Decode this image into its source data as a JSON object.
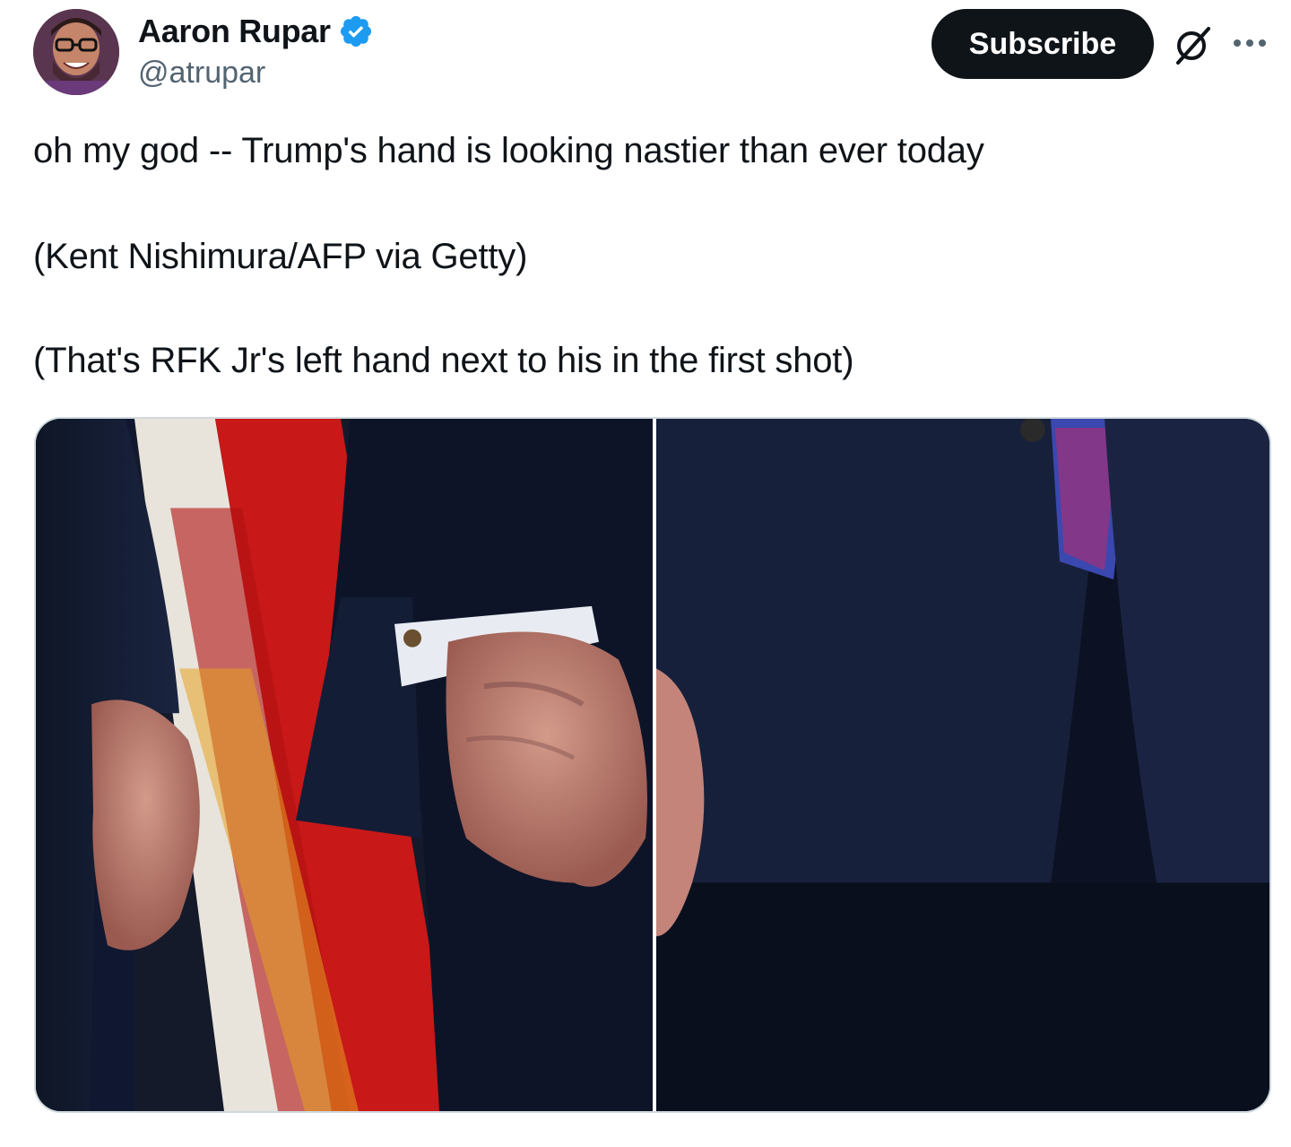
{
  "author": {
    "display_name": "Aaron Rupar",
    "handle": "@atrupar",
    "verified": true,
    "avatar_icon": "avatar"
  },
  "actions": {
    "subscribe_label": "Subscribe",
    "grok_icon": "grok-icon",
    "more_icon": "more-icon"
  },
  "tweet": {
    "lines": [
      "oh my god -- Trump's hand is looking nastier than ever today",
      "(Kent Nishimura/AFP via Getty)",
      "(That's RFK Jr's left hand next to his in the first shot)"
    ]
  },
  "media": {
    "count": 2
  },
  "colors": {
    "text": "#0f1419",
    "secondary": "#536471",
    "verified": "#1d9bf0",
    "button_bg": "#0f1419",
    "button_text": "#ffffff"
  }
}
